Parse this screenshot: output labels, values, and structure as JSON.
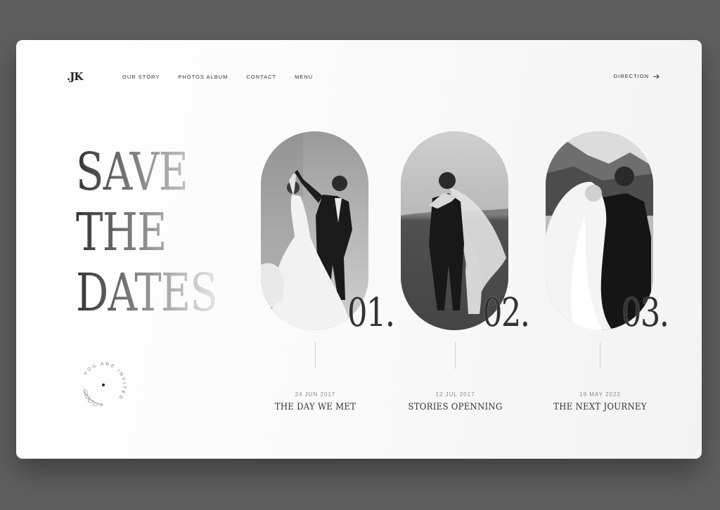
{
  "header": {
    "logo": ".JK",
    "nav": [
      "OUR STORY",
      "PHOTOS ALBUM",
      "CONTACT",
      "MENU"
    ],
    "direction_label": "DIRECTION",
    "direction_icon": "arrow-right-icon"
  },
  "hero": {
    "lines": [
      "SAVE",
      "THE",
      "DATES"
    ]
  },
  "badge": {
    "text": "YOU ARE INVITED",
    "icon": "floral-sprig-icon"
  },
  "moments": [
    {
      "number": "01.",
      "date": "24 JUN 2017",
      "title": "THE DAY WE MET"
    },
    {
      "number": "02.",
      "date": "12 JUL 2017",
      "title": "STORIES OPENNING"
    },
    {
      "number": "03.",
      "date": "19 MAY 2022",
      "title": "THE NEXT JOURNEY"
    }
  ],
  "colors": {
    "backdrop": "#5f5f5f",
    "card": "#f8f8f8",
    "text": "#333333",
    "muted": "#888888"
  }
}
